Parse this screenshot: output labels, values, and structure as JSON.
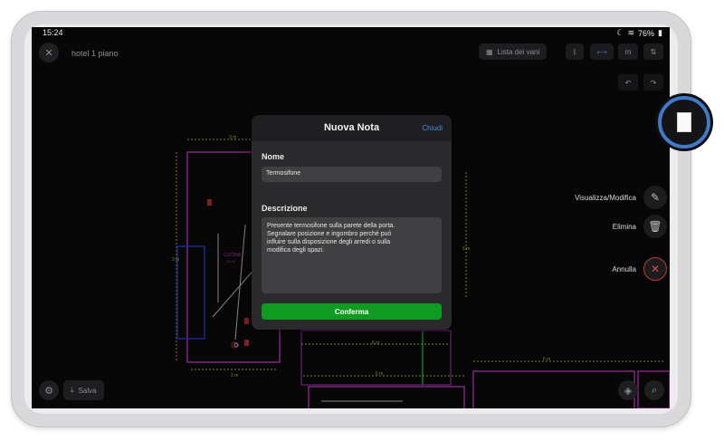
{
  "status_bar": {
    "time": "15:24",
    "battery": "76%"
  },
  "header": {
    "project_title": "hotel 1 piano",
    "rooms_list_label": "Lista dei vani",
    "unit_label": "m"
  },
  "modal": {
    "title": "Nuova Nota",
    "close_label": "Chiudi",
    "name_label": "Nome",
    "name_value": "Termosifone",
    "description_label": "Descrizione",
    "description_value": "Presente termosifone sulla parete della porta.\nSegnalare posizione e ingombro perché può\ninfluire sulla disposizione degli arredi o sulla\nmodifica degli spazi.",
    "confirm_label": "Conferma"
  },
  "side_actions": {
    "view_edit": "Visualizza/Modifica",
    "delete": "Elimina",
    "cancel": "Annulla"
  },
  "bottom_bar": {
    "save_label": "Salva"
  },
  "plan": {
    "dimension_labels": [
      "3 m",
      "3 m",
      "3 m",
      "6 m",
      "5 m",
      "6 m",
      "5 m",
      "5 m",
      "3 m"
    ],
    "room_label": "CUCINA",
    "room_area": "21 m²"
  },
  "colors": {
    "accent_blue": "#4a88d8",
    "confirm_green": "#0f9b1f",
    "plan_magenta": "#c13bc6",
    "dimension_yellow": "#b7c63a"
  }
}
